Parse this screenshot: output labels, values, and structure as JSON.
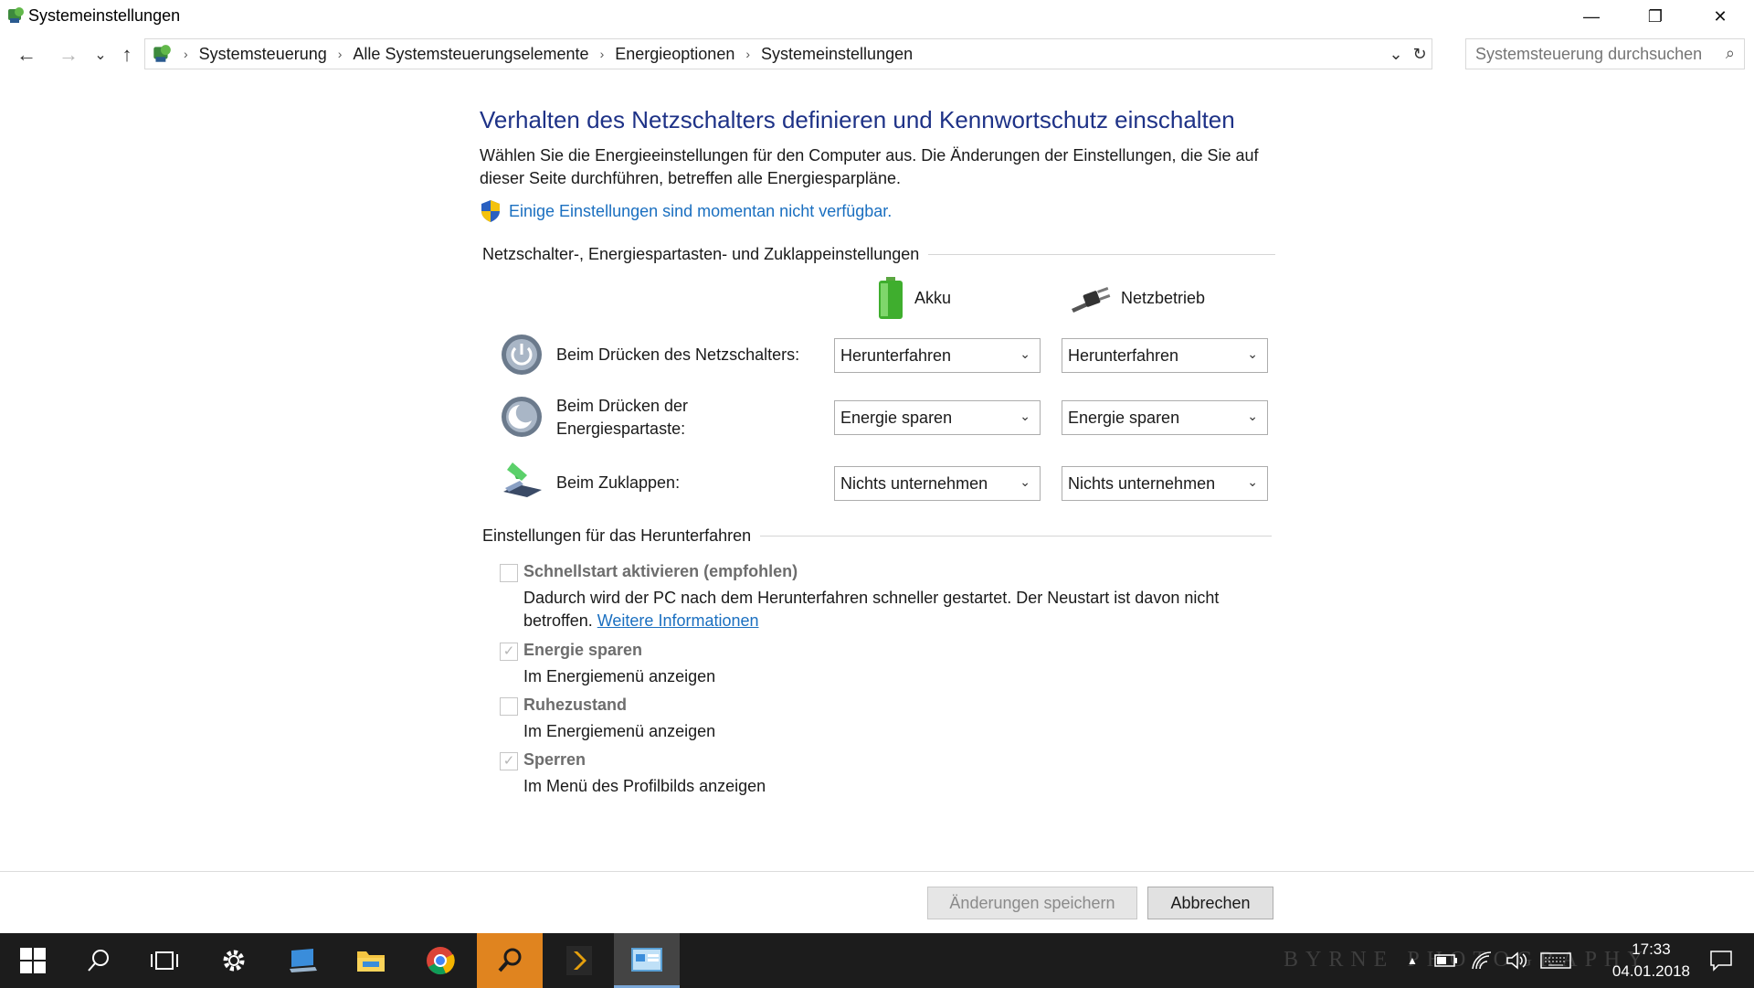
{
  "window": {
    "title": "Systemeinstellungen",
    "minimize": "—",
    "restore": "❐",
    "close": "✕"
  },
  "navigation": {
    "back": "←",
    "forward": "→",
    "recent": "⌄",
    "up": "↑",
    "breadcrumbs": [
      "Systemsteuerung",
      "Alle Systemsteuerungselemente",
      "Energieoptionen",
      "Systemeinstellungen"
    ],
    "separator": "›",
    "dropdown": "⌄",
    "refresh": "↻",
    "search_placeholder": "Systemsteuerung durchsuchen",
    "search_icon": "⌕"
  },
  "page": {
    "heading": "Verhalten des Netzschalters definieren und Kennwortschutz einschalten",
    "description": "Wählen Sie die Energieeinstellungen für den Computer aus. Die Änderungen der Einstellungen, die Sie auf dieser Seite durchführen, betreffen alle Energiesparpläne.",
    "notice_link": "Einige Einstellungen sind momentan nicht verfügbar."
  },
  "buttons_group": {
    "title": "Netzschalter-, Energiespartasten- und Zuklappeinstellungen",
    "col_battery": "Akku",
    "col_power": "Netzbetrieb",
    "rows": [
      {
        "label": "Beim Drücken des Netzschalters:",
        "battery": "Herunterfahren",
        "power": "Herunterfahren"
      },
      {
        "label": "Beim Drücken der Energiespartaste:",
        "battery": "Energie sparen",
        "power": "Energie sparen"
      },
      {
        "label": "Beim Zuklappen:",
        "battery": "Nichts unternehmen",
        "power": "Nichts unternehmen"
      }
    ],
    "chevron": "⌄"
  },
  "shutdown_group": {
    "title": "Einstellungen für das Herunterfahren",
    "fast_start": {
      "title": "Schnellstart aktivieren (empfohlen)",
      "desc": "Dadurch wird der PC nach dem Herunterfahren schneller gestartet. Der Neustart ist davon nicht betroffen.",
      "link": "Weitere Informationen",
      "checked": false
    },
    "sleep": {
      "title": "Energie sparen",
      "desc": "Im Energiemenü anzeigen",
      "checked": true
    },
    "hibernate": {
      "title": "Ruhezustand",
      "desc": "Im Energiemenü anzeigen",
      "checked": false
    },
    "lock": {
      "title": "Sperren",
      "desc": "Im Menü des Profilbilds anzeigen",
      "checked": true
    },
    "check_mark": "✓"
  },
  "footer": {
    "save": "Änderungen speichern",
    "cancel": "Abbrechen"
  },
  "taskbar": {
    "watermark": "BYRNE PHOTOGRAPHY",
    "time": "17:33",
    "date": "04.01.2018",
    "tray_up": "▲"
  },
  "colors": {
    "heading": "#1e3287",
    "link": "#1a6fc0",
    "taskbar": "#1c1c1c"
  }
}
